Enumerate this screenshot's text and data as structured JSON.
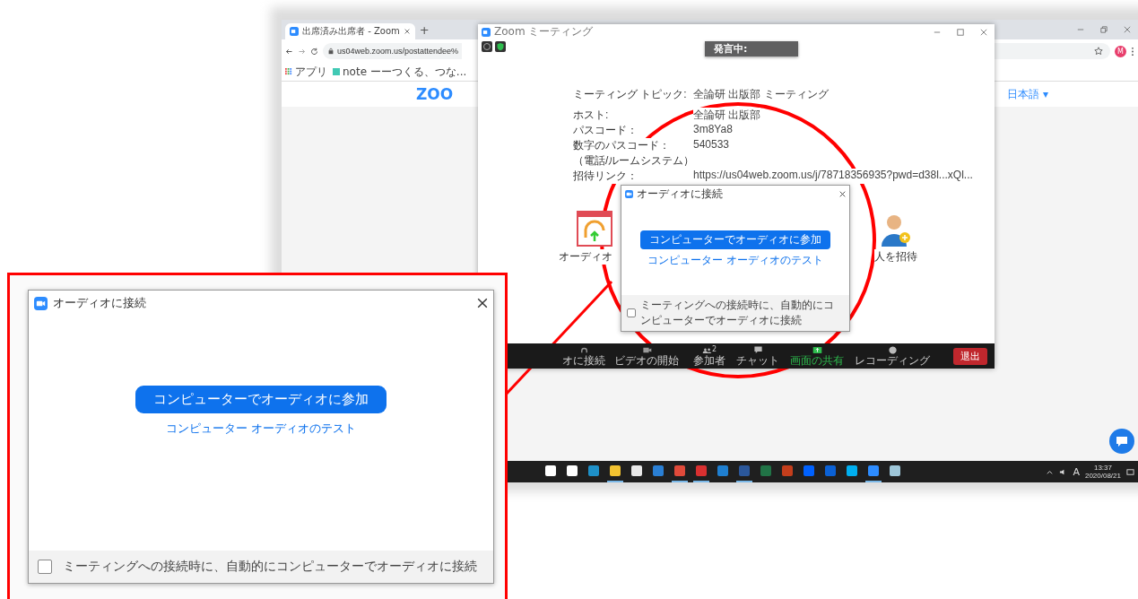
{
  "browser": {
    "tab_title": "出席済み出席者 - Zoom",
    "new_tab": "+",
    "address": "us04web.zoom.us/postattendee%",
    "bookmarks": [
      {
        "label": "アプリ",
        "kind": "apps"
      },
      {
        "label": "note ーーつくる、つな...",
        "kind": "page"
      }
    ],
    "logo": "ZOO",
    "language": "日本語 ▾",
    "profile": "M"
  },
  "zoom_window": {
    "title": "Zoom ミーティング",
    "speaker_badge": "発言中:",
    "info": [
      {
        "label": "ミーティング トピック:",
        "value": "全論研 出版部 ミーティング"
      },
      {
        "label": "ホスト:",
        "value": "全論研 出版部"
      },
      {
        "label": "パスコード：",
        "value": "3m8Ya8"
      },
      {
        "label": "数字のパスコード：",
        "value": "540533"
      },
      {
        "label": "（電話/ルームシステム）"
      },
      {
        "label": "招待リンク：",
        "value": "https://us04web.zoom.us/j/78718356935?pwd=d38l...xQl..."
      }
    ],
    "features": [
      {
        "kind": "audio",
        "label": "オーディオ"
      },
      {
        "kind": "invite",
        "label": "人を招待"
      }
    ],
    "toolbar": [
      {
        "kind": "audio",
        "label": "オに接続"
      },
      {
        "kind": "video",
        "label": "ビデオの開始"
      },
      {
        "kind": "participants",
        "label": "参加者",
        "count": "2"
      },
      {
        "kind": "chat",
        "label": "チャット"
      },
      {
        "kind": "share",
        "label": "画面の共有"
      },
      {
        "kind": "record",
        "label": "レコーディング"
      }
    ],
    "leave": "退出"
  },
  "audio_dialog": {
    "title": "オーディオに接続",
    "join_button": "コンピューターでオーディオに参加",
    "test_link": "コンピューター オーディオのテスト",
    "auto_connect": {
      "label": "ミーティングへの接続時に、自動的にコンピューターでオーディオに接続",
      "checked": false
    }
  },
  "callout_dialog": {
    "title": "オーディオに接続",
    "join_button": "コンピューターでオーディオに参加",
    "test_link": "コンピューター オーディオのテスト",
    "auto_connect": {
      "label": "ミーティングへの接続時に、自動的にコンピューターでオーディオに接続",
      "checked": false
    }
  },
  "taskbar": {
    "apps": [
      {
        "color": "#ffffff",
        "active": false
      },
      {
        "color": "#ffffff",
        "active": false
      },
      {
        "color": "#1e90c8",
        "active": false
      },
      {
        "color": "#f2c230",
        "active": true
      },
      {
        "color": "#e8e8e8",
        "active": false
      },
      {
        "color": "#2a7fd4",
        "active": false
      },
      {
        "color": "#e04a3a",
        "active": true
      },
      {
        "color": "#d93030",
        "active": true
      },
      {
        "color": "#1f7fd0",
        "active": false
      },
      {
        "color": "#2b579a",
        "active": true
      },
      {
        "color": "#217346",
        "active": false
      },
      {
        "color": "#c43e1c",
        "active": false
      },
      {
        "color": "#0061fe",
        "active": false
      },
      {
        "color": "#0b61d5",
        "active": false
      },
      {
        "color": "#00aff0",
        "active": false
      },
      {
        "color": "#2d8cff",
        "active": true
      },
      {
        "color": "#9ec6d8",
        "active": false
      }
    ],
    "ime": "A",
    "time": "13:37",
    "date": "2020/08/21"
  }
}
